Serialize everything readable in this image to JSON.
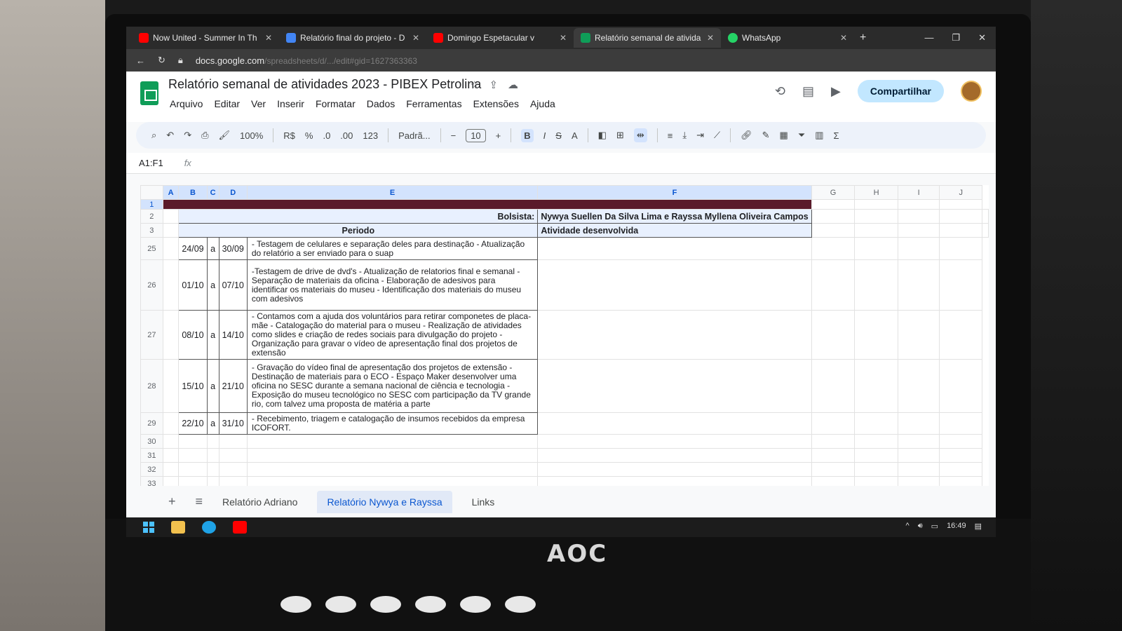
{
  "browser": {
    "tabs": [
      {
        "title": "Now United - Summer In Th",
        "color": "#ff0000"
      },
      {
        "title": "Relatório final do projeto - D",
        "color": "#4285f4"
      },
      {
        "title": "Domingo Espetacular v",
        "color": "#ff0000"
      },
      {
        "title": "Relatório semanal de ativida",
        "color": "#0f9d58"
      },
      {
        "title": "WhatsApp",
        "color": "#25d366"
      }
    ],
    "url": "docs.google.com",
    "url_rest": "/spreadsheets/d/.../edit#gid=1627363363"
  },
  "doc": {
    "title": "Relatório semanal de atividades 2023 - PIBEX Petrolina",
    "menus": [
      "Arquivo",
      "Editar",
      "Ver",
      "Inserir",
      "Formatar",
      "Dados",
      "Ferramentas",
      "Extensões",
      "Ajuda"
    ],
    "share_label": "Compartilhar"
  },
  "toolbar": {
    "zoom": "100%",
    "currency": "R$",
    "percent": "%",
    "dec_dec": ".0",
    "dec_inc": ".00",
    "format_123": "123",
    "font": "Padrã...",
    "font_size": "10",
    "bold": "B",
    "italic": "I",
    "strike": "S",
    "text_color": "A",
    "sum": "Σ"
  },
  "formula_bar": {
    "cell_ref": "A1:F1",
    "fx": "fx"
  },
  "columns": [
    "A",
    "B",
    "C",
    "D",
    "E",
    "F",
    "G",
    "H",
    "I",
    "J"
  ],
  "sheet": {
    "header": {
      "bolsista_label": "Bolsista:",
      "bolsista_value": "Nywya Suellen Da Silva Lima e Rayssa Myllena Oliveira Campos",
      "periodo_label": "Periodo",
      "atividade_label": "Atividade desenvolvida"
    },
    "rows": [
      {
        "n": "25",
        "from": "24/09",
        "a": "a",
        "to": "30/09",
        "text": "- Testagem de celulares e separação deles para destinação\n- Atualização do relatório a ser enviado para o suap"
      },
      {
        "n": "26",
        "from": "01/10",
        "a": "a",
        "to": "07/10",
        "text": "-Testagem de drive de dvd's\n- Atualização de relatorios final e semanal\n- Separação de materiais da oficina\n- Elaboração de adesivos para identificar os materiais do museu\n- Identificação dos materiais do museu com adesivos"
      },
      {
        "n": "27",
        "from": "08/10",
        "a": "a",
        "to": "14/10",
        "text": "- Contamos com a ajuda dos voluntários para retirar componetes de placa-mãe\n- Catalogação do material para o museu\n- Realização de atividades como slides e criação de redes sociais para divulgação do projeto\n- Organização para gravar o vídeo de apresentação final dos projetos de extensão"
      },
      {
        "n": "28",
        "from": "15/10",
        "a": "a",
        "to": "21/10",
        "text": "- Gravação do vídeo final de apresentação dos projetos de extensão\n- Destinação de materiais para o ECO - Espaço Maker desenvolver uma oficina no SESC durante a semana nacional de ciência e tecnologia\n- Exposição do museu tecnológico no SESC com participação da TV grande rio, com talvez uma proposta de matéria a parte"
      },
      {
        "n": "29",
        "from": "22/10",
        "a": "a",
        "to": "31/10",
        "text": "- Recebimento, triagem e catalogação de insumos recebidos da empresa ICOFORT."
      }
    ],
    "empty_rows": [
      "30",
      "31",
      "32",
      "33"
    ]
  },
  "sheet_tabs": [
    {
      "label": "Relatório Adriano",
      "active": false
    },
    {
      "label": "Relatório Nywya e Rayssa",
      "active": true
    },
    {
      "label": "Links",
      "active": false
    }
  ],
  "taskbar": {
    "time": "16:49"
  },
  "monitor": {
    "brand": "AOC"
  }
}
